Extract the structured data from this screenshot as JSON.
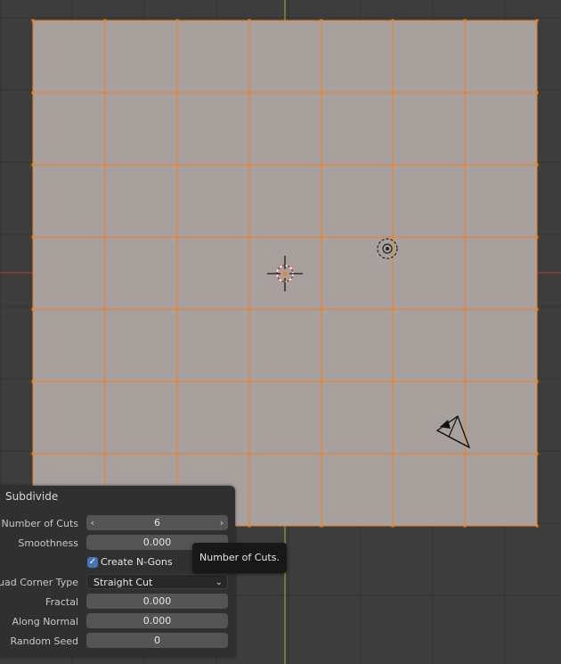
{
  "viewport": {
    "grid_color": "#353535",
    "mesh_face_color": "#a7a09d",
    "mesh_edge_color": "#e8832a",
    "axis_x_color": "#c0383f",
    "axis_y_color": "#6a9a2a",
    "icons": [
      "3d-cursor-icon",
      "light-icon",
      "camera-icon"
    ]
  },
  "panel": {
    "title": "Subdivide",
    "number_of_cuts": {
      "label": "Number of Cuts",
      "value": "6",
      "decrement": "‹",
      "increment": "›"
    },
    "smoothness": {
      "label": "Smoothness",
      "value": "0.000"
    },
    "create_ngons": {
      "label": "Create N-Gons",
      "checked": true,
      "check_glyph": "✓"
    },
    "quad_corner_type": {
      "label": "Quad Corner Type",
      "value": "Straight Cut",
      "chevron": "⌄"
    },
    "fractal": {
      "label": "Fractal",
      "value": "0.000"
    },
    "along_normal": {
      "label": "Along Normal",
      "value": "0.000"
    },
    "random_seed": {
      "label": "Random Seed",
      "value": "0"
    }
  },
  "tooltip": {
    "text": "Number of Cuts."
  }
}
